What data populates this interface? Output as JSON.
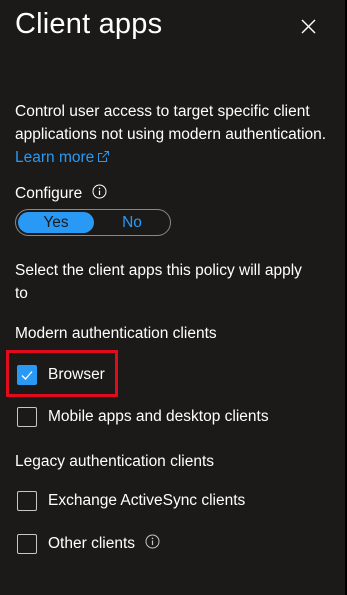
{
  "panel": {
    "title": "Client apps",
    "close_icon": "close-icon"
  },
  "description": {
    "text": "Control user access to target specific client applications not using modern authentication.",
    "learn_more": "Learn more",
    "link_icon": "external-link-icon"
  },
  "configure": {
    "label": "Configure",
    "info_icon": "info-icon",
    "options": [
      "Yes",
      "No"
    ],
    "selected": "Yes"
  },
  "select_text": "Select the client apps this policy will apply to",
  "modern_section": {
    "label": "Modern authentication clients",
    "items": [
      {
        "label": "Browser",
        "checked": true
      },
      {
        "label": "Mobile apps and desktop clients",
        "checked": false
      }
    ]
  },
  "legacy_section": {
    "label": "Legacy authentication clients",
    "items": [
      {
        "label": "Exchange ActiveSync clients",
        "checked": false
      },
      {
        "label": "Other clients",
        "checked": false,
        "info_icon": "info-icon"
      }
    ]
  },
  "colors": {
    "background": "#1b1a19",
    "accent": "#2899f5",
    "highlight": "#e00b1c",
    "text": "#ffffff"
  }
}
